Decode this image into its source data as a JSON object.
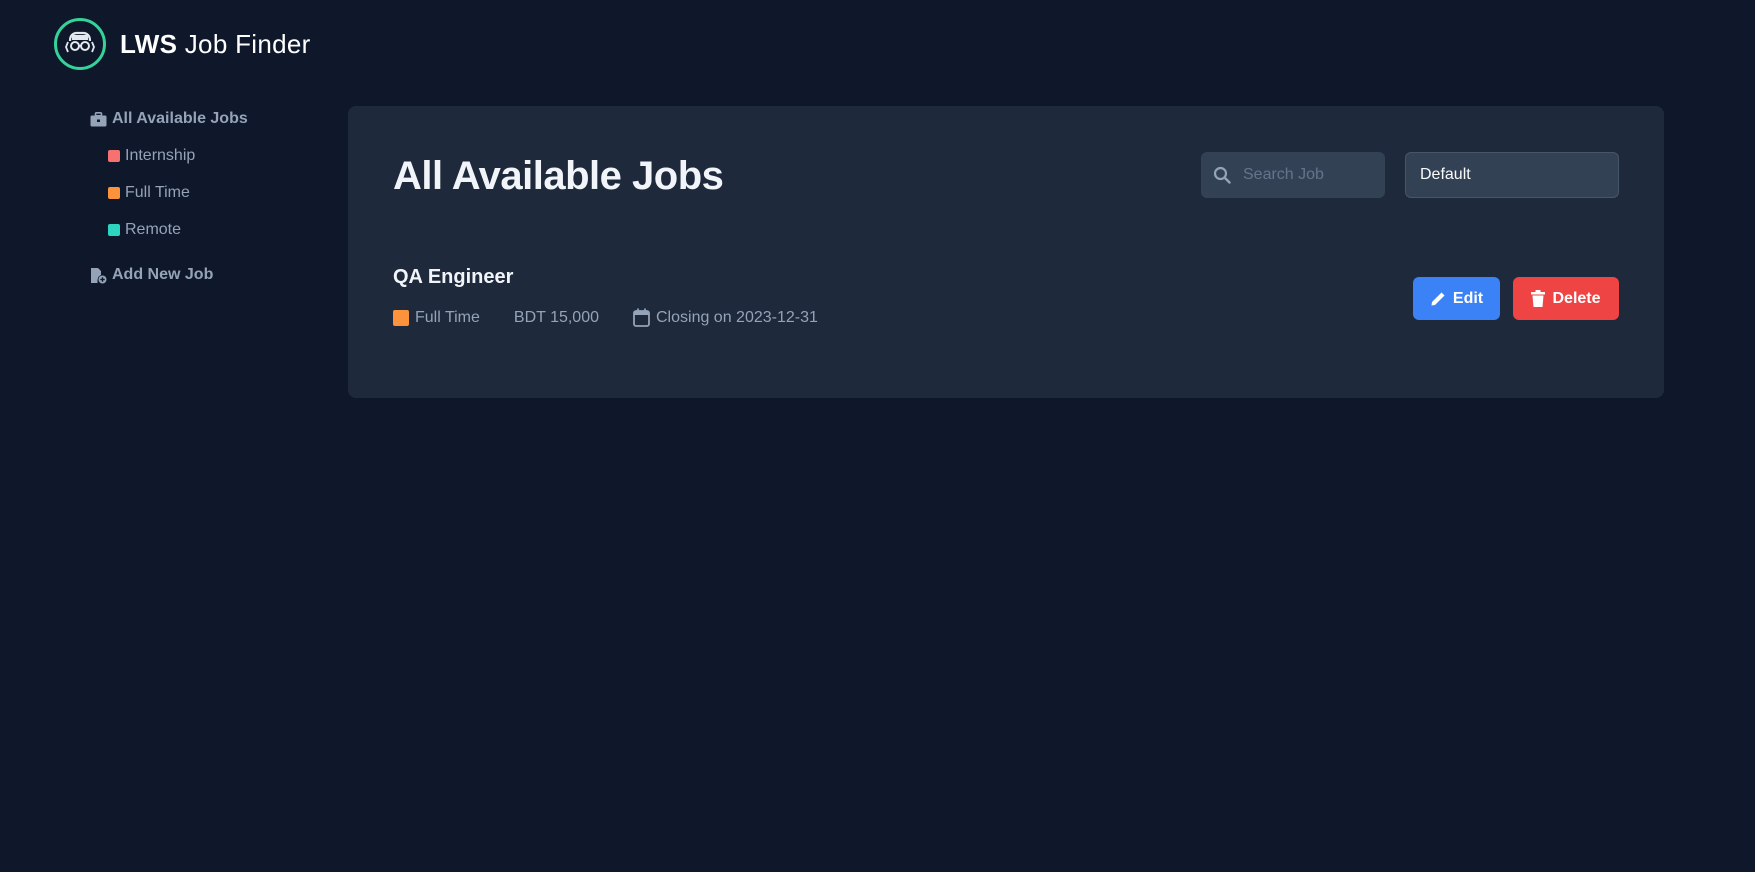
{
  "header": {
    "brand_bold": "LWS",
    "brand_rest": " Job Finder",
    "logo_icon": "developer-glasses-icon",
    "accent_color": "#34d399"
  },
  "sidebar": {
    "all_jobs_label": "All Available Jobs",
    "filters": [
      {
        "label": "Internship",
        "color": "#f87171"
      },
      {
        "label": "Full Time",
        "color": "#fb923c"
      },
      {
        "label": "Remote",
        "color": "#2dd4bf"
      }
    ],
    "add_job_label": "Add New Job"
  },
  "main": {
    "title": "All Available Jobs",
    "search": {
      "placeholder": "Search Job",
      "value": ""
    },
    "sort": {
      "selected": "Default"
    },
    "jobs": [
      {
        "title": "QA Engineer",
        "type": "Full Time",
        "type_color": "#fb923c",
        "salary": "BDT 15,000",
        "deadline": "Closing on 2023-12-31",
        "edit_label": "Edit",
        "delete_label": "Delete"
      }
    ]
  },
  "colors": {
    "background": "#0f172a",
    "panel": "#1e293b",
    "edit_button": "#3b82f6",
    "delete_button": "#ef4444"
  }
}
